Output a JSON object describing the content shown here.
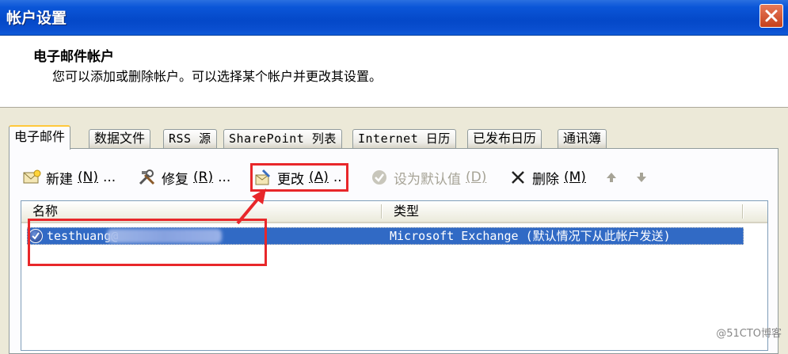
{
  "window": {
    "title": "帐户设置"
  },
  "header": {
    "heading": "电子邮件帐户",
    "description": "您可以添加或删除帐户。可以选择某个帐户并更改其设置。"
  },
  "tabs": [
    "电子邮件",
    "数据文件",
    "RSS 源",
    "SharePoint 列表",
    "Internet 日历",
    "已发布日历",
    "通讯簿"
  ],
  "toolbar": {
    "new_label": "新建",
    "new_key": "(N)",
    "new_suffix": "...",
    "repair_label": "修复",
    "repair_key": "(R)",
    "repair_suffix": "...",
    "change_label": "更改",
    "change_key": "(A)",
    "change_suffix": "..",
    "default_label": "设为默认值",
    "default_key": "(D)",
    "delete_label": "删除",
    "delete_key": "(M)"
  },
  "list": {
    "columns": [
      "名称",
      "类型"
    ],
    "rows": [
      {
        "name": "testhuang@",
        "type": "Microsoft Exchange (默认情况下从此帐户发送)"
      }
    ]
  },
  "watermark": "@51CTO博客",
  "colors": {
    "title_bar": "#0448c8",
    "selection": "#316ac5",
    "annotation": "#e8272a"
  }
}
